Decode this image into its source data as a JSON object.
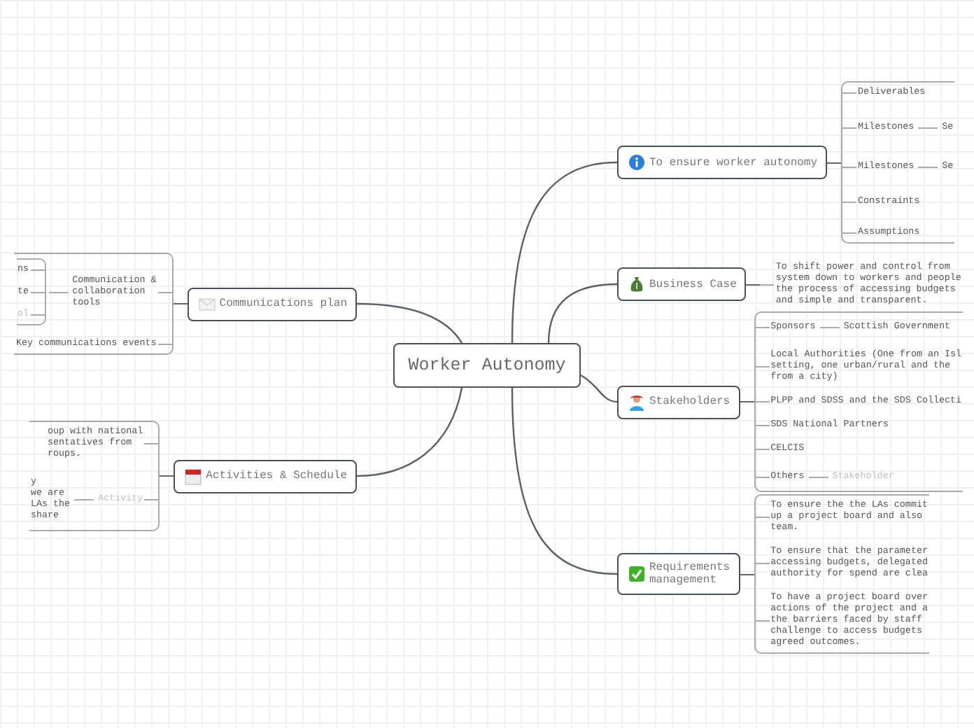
{
  "title": "Worker Autonomy",
  "branches": [
    {
      "label": "To ensure worker autonomy",
      "children": [
        {
          "label": "Deliverables",
          "muted": false
        },
        {
          "label": "Milestones",
          "muted": false,
          "children": [
            {
              "label": "Se",
              "muted": false
            }
          ]
        },
        {
          "label": "Milestones",
          "muted": false,
          "children": [
            {
              "label": "Se",
              "muted": false
            }
          ]
        },
        {
          "label": "Constraints",
          "muted": false
        },
        {
          "label": "Assumptions",
          "muted": false
        }
      ]
    },
    {
      "label": "Business Case",
      "children": [
        {
          "label": "To shift power and control from\nsystem down to workers and people\nthe process of accessing budgets\nand simple and transparent.",
          "muted": false
        }
      ]
    },
    {
      "label": "Stakeholders",
      "children": [
        {
          "label": "Sponsors",
          "muted": false,
          "children": [
            {
              "label": "Scottish Government",
              "muted": false
            }
          ]
        },
        {
          "label": "Local Authorities (One from an Isl\nsetting, one urban/rural and the\nfrom a city)",
          "muted": false
        },
        {
          "label": "PLPP and SDSS and the SDS Collecti",
          "muted": false
        },
        {
          "label": "SDS National Partners",
          "muted": false
        },
        {
          "label": "CELCIS",
          "muted": false
        },
        {
          "label": "Others",
          "muted": false,
          "children": [
            {
              "label": "Stakeholder",
              "muted": true
            }
          ]
        }
      ]
    },
    {
      "label": "Requirements\nmanagement",
      "children": [
        {
          "label": "To ensure the the LAs commit\nup a project board and also\nteam.",
          "muted": false
        },
        {
          "label": "To ensure that the parameter\naccessing budgets, delegated\nauthority for spend are clea",
          "muted": false
        },
        {
          "label": "To have a project board over\nactions of the project and a\nthe barriers faced by staff\nchallenge to access budgets\nagreed outcomes.",
          "muted": false
        }
      ]
    },
    {
      "label": "Communications plan",
      "children": [
        {
          "label": "Communication &\ncollaboration\ntools",
          "muted": false,
          "children": [
            {
              "label": "ns",
              "muted": false
            },
            {
              "label": "te",
              "muted": false
            },
            {
              "label": "ol",
              "muted": true
            }
          ]
        },
        {
          "label": "Key communications events",
          "muted": false
        }
      ]
    },
    {
      "label": "Activities & Schedule",
      "children": [
        {
          "label": "oup with national\nsentatives from\nroups.",
          "muted": false
        },
        {
          "label": "Activity",
          "muted": true,
          "children": [
            {
              "label": "y\nwe are\nLAs the\nshare",
              "muted": false
            }
          ]
        }
      ]
    }
  ]
}
